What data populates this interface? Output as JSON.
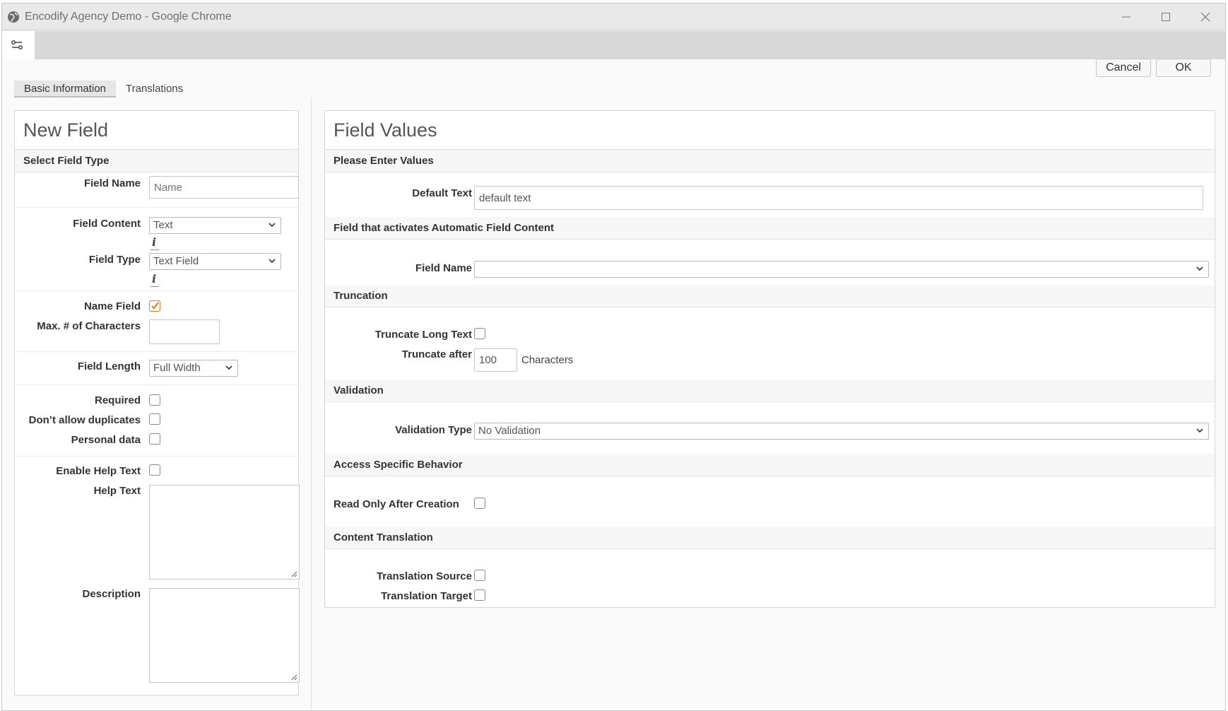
{
  "window": {
    "title": "Encodify Agency Demo - Google Chrome"
  },
  "dialog": {
    "cancel_label": "Cancel",
    "ok_label": "OK"
  },
  "tabs": [
    {
      "label": "Basic Information",
      "active": true
    },
    {
      "label": "Translations",
      "active": false
    }
  ],
  "left": {
    "title": "New Field",
    "section": "Select Field Type",
    "field_name": {
      "label": "Field Name",
      "placeholder": "Name"
    },
    "field_content": {
      "label": "Field Content",
      "value": "Text"
    },
    "field_type": {
      "label": "Field Type",
      "value": "Text Field"
    },
    "info_icon": "i",
    "name_field": {
      "label": "Name Field",
      "checked": true
    },
    "max_chars": {
      "label": "Max. # of Characters",
      "value": ""
    },
    "field_length": {
      "label": "Field Length",
      "value": "Full Width"
    },
    "required": {
      "label": "Required",
      "checked": false
    },
    "no_duplicates": {
      "label": "Don’t allow duplicates",
      "checked": false
    },
    "personal_data": {
      "label": "Personal data",
      "checked": false
    },
    "enable_help": {
      "label": "Enable Help Text",
      "checked": false
    },
    "help_text": {
      "label": "Help Text",
      "value": ""
    },
    "description": {
      "label": "Description",
      "value": ""
    }
  },
  "right": {
    "title": "Field Values",
    "sections": {
      "values": "Please Enter Values",
      "auto": "Field that activates Automatic Field Content",
      "truncation": "Truncation",
      "validation": "Validation",
      "access": "Access Specific Behavior",
      "translation": "Content Translation"
    },
    "default_text": {
      "label": "Default Text",
      "value": "default text"
    },
    "auto_field_name": {
      "label": "Field Name",
      "value": ""
    },
    "truncate_long": {
      "label": "Truncate Long Text",
      "checked": false
    },
    "truncate_after": {
      "label": "Truncate after",
      "value": "100",
      "unit": "Characters"
    },
    "validation_type": {
      "label": "Validation Type",
      "value": "No Validation"
    },
    "read_only": {
      "label": "Read Only After Creation",
      "checked": false
    },
    "translation_source": {
      "label": "Translation Source",
      "checked": false
    },
    "translation_target": {
      "label": "Translation Target",
      "checked": false
    }
  },
  "colors": {
    "checkbox_accent": "#e07a12"
  }
}
